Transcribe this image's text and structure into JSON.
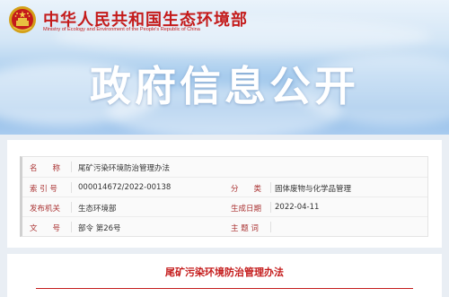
{
  "header": {
    "site_title": "中华人民共和国生态环境部",
    "site_subtitle": "Ministry of Ecology and Environment of the People's Republic of China",
    "emblem_icon": "national-emblem-icon",
    "banner_title": "政府信息公开",
    "colors": {
      "brand_red": "#c41b1b",
      "sky_blue": "#8ab9e6"
    }
  },
  "info": {
    "name_label": "名　　称",
    "name_value": "尾矿污染环境防治管理办法",
    "index_label": "索 引 号",
    "index_value": "000014672/2022-00138",
    "category_label": "分　　类",
    "category_value": "固体废物与化学品管理",
    "issuer_label": "发布机关",
    "issuer_value": "生态环境部",
    "date_label": "生成日期",
    "date_value": "2022-04-11",
    "docnum_label": "文　　号",
    "docnum_value": "部令 第26号",
    "keywords_label": "主 题 词",
    "keywords_value": ""
  },
  "document": {
    "title": "尾矿污染环境防治管理办法"
  }
}
